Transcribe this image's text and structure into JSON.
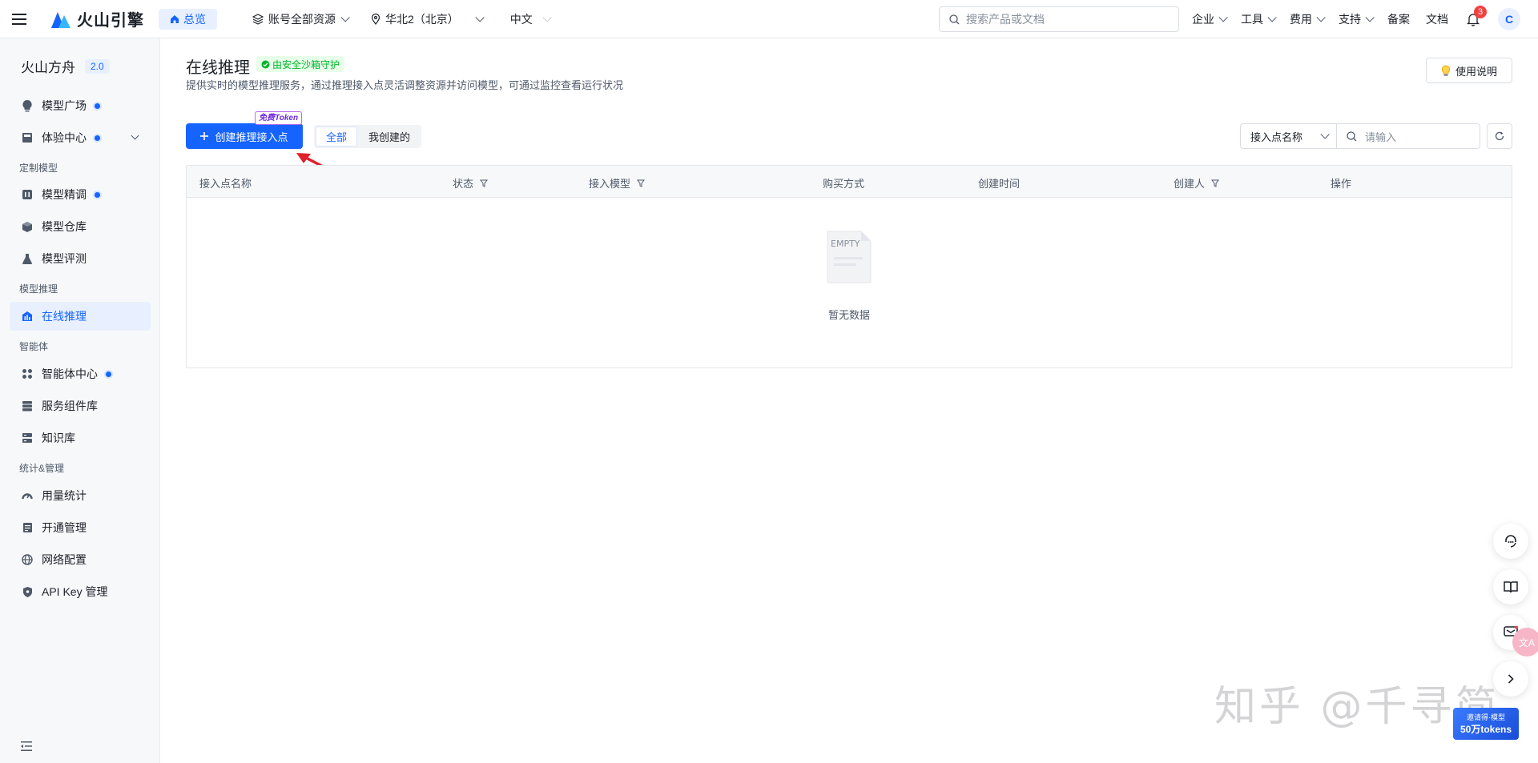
{
  "topbar": {
    "brand": "火山引擎",
    "home_label": "总览",
    "account_select": "账号全部资源",
    "region_select": "华北2（北京）",
    "language_select": "中文",
    "search_placeholder": "搜索产品或文档",
    "nav": {
      "enterprise": "企业",
      "tools": "工具",
      "billing": "费用",
      "support": "支持",
      "icp": "备案",
      "docs": "文档"
    },
    "notification_count": "3",
    "avatar_initial": "C"
  },
  "sidebar": {
    "product_name": "火山方舟",
    "version": "2.0",
    "items": [
      {
        "label": "模型广场",
        "icon": "bulb-icon",
        "dot": true
      },
      {
        "label": "体验中心",
        "icon": "monitor-icon",
        "dot": true,
        "expandable": true
      },
      {
        "label": "模型精调",
        "icon": "tune-icon",
        "dot": true
      },
      {
        "label": "模型仓库",
        "icon": "cube-icon",
        "dot": false
      },
      {
        "label": "模型评测",
        "icon": "flask-icon",
        "dot": false
      },
      {
        "label": "在线推理",
        "icon": "chart-bars-icon",
        "dot": false,
        "active": true
      },
      {
        "label": "智能体中心",
        "icon": "apps-icon",
        "dot": true
      },
      {
        "label": "服务组件库",
        "icon": "layers-icon",
        "dot": false
      },
      {
        "label": "知识库",
        "icon": "database-icon",
        "dot": false
      },
      {
        "label": "用量统计",
        "icon": "gauge-icon",
        "dot": false
      },
      {
        "label": "开通管理",
        "icon": "doc-icon",
        "dot": false
      },
      {
        "label": "网络配置",
        "icon": "globe-icon",
        "dot": false
      },
      {
        "label": "API Key 管理",
        "icon": "shield-icon",
        "dot": false
      }
    ],
    "groups": {
      "custom_models": "定制模型",
      "model_inference": "模型推理",
      "agents": "智能体",
      "stats_mgmt": "统计&管理"
    }
  },
  "main": {
    "title": "在线推理",
    "guard_tag": "由安全沙箱守护",
    "description": "提供实时的模型推理服务，通过推理接入点灵活调整资源并访问模型，可通过监控查看运行状况",
    "help_button": "使用说明",
    "create_button": "创建推理接入点",
    "token_tag": "免费Token",
    "segments": [
      "全部",
      "我创建的"
    ],
    "filter_field": "接入点名称",
    "filter_placeholder": "请输入",
    "columns": [
      "接入点名称",
      "状态",
      "接入模型",
      "购买方式",
      "创建时间",
      "创建人",
      "操作"
    ],
    "empty_text": "暂无数据",
    "empty_image_label": "EMPTY"
  },
  "promo": {
    "line1": "邀请得·模型",
    "line2": "50万tokens"
  },
  "translate_fab": "文A",
  "watermark": "知乎 @千寻简",
  "colors": {
    "primary": "#1664ff",
    "sidebar_bg": "#f7f8fa",
    "active_bg": "#e8f0ff",
    "annotation_arrow": "#e0202a"
  }
}
